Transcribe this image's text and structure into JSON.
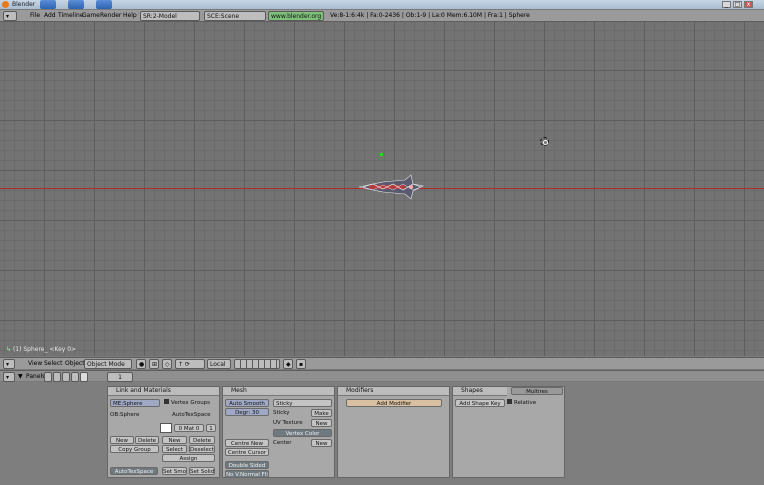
{
  "window": {
    "title": "Blender"
  },
  "infobar": {
    "menus": [
      "File",
      "Add",
      "Timeline",
      "Game",
      "Render",
      "Help"
    ],
    "screen_field": "SR:2-Model",
    "scene_field": "SCE:Scene",
    "engine_field": "www.blender.org 249",
    "stats": "Ve:8-1:6:4k | Fa:0-2436 | Ob:1-9 | La:0  Mem:6.10M | Fra:1 | Sphere"
  },
  "viewport": {
    "label": "(1) Sphere_ <Key 0>",
    "cursor_icon": "3d-cursor-icon"
  },
  "vpheader": {
    "menus": [
      "View",
      "Select",
      "Object"
    ],
    "mode": "Object Mode",
    "pivot": "Local",
    "layers_icon": "layer-grid-icon"
  },
  "btnheader": {
    "panels_label": "Panels",
    "frame": "1"
  },
  "panels": {
    "link_materials": {
      "title": "Link and Materials",
      "me_field": "ME:Sphere",
      "ob_field": "OB:Sphere",
      "vertex_groups": "Vertex Groups",
      "auto_tex": "AutoTexSpace",
      "mat_count": "0 Mat 0",
      "mat_index": "1",
      "new": "New",
      "delete": "Delete",
      "copy_group": "Copy Group",
      "select": "Select",
      "deselect": "Deselect",
      "assign": "Assign",
      "set_smooth": "Set Smooth",
      "set_solid": "Set Solid",
      "new2": "New",
      "delete2": "Delete",
      "select2": "Select",
      "deselect2": "Deselect"
    },
    "mesh": {
      "title": "Mesh",
      "auto_smooth": "Auto Smooth",
      "degr": "Degr: 30",
      "sticky": "Sticky",
      "make": "Make",
      "uv_texture": "UV Texture",
      "new": "New",
      "vertex_color": "Vertex Color",
      "center": "Center",
      "tex_mesh": "TexMesh:",
      "texmesh_val": "",
      "centre_new": "Centre New",
      "centre_cursor": "Centre Cursor",
      "double_sided": "Double Sided",
      "no_vnormal_flip": "No V.Normal Flip"
    },
    "modifiers": {
      "title": "Modifiers",
      "add": "Add Modifier"
    },
    "shapes": {
      "title": "Shapes",
      "tab2": "Multires",
      "add_shape": "Add Shape Key",
      "relative": "Relative"
    }
  }
}
